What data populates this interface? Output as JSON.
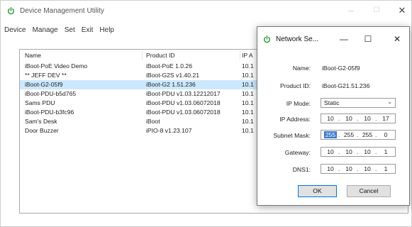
{
  "main_window": {
    "title": "Device Management Utility",
    "menu": [
      "Device",
      "Manage",
      "Set",
      "Exit",
      "Help"
    ],
    "controls": {
      "minimize": "–",
      "maximize": "☐",
      "close": "✕"
    }
  },
  "device_list": {
    "headers": [
      "Name",
      "Product ID",
      "IP A"
    ],
    "rows": [
      [
        "iBoot-PoE Video Demo",
        "iBoot-PoE 1.0.26",
        "10.1"
      ],
      [
        "** JEFF DEV **",
        "iBoot-G2S v1.40.21",
        "10.1"
      ],
      [
        "iBoot-G2-05f9",
        "iBoot-G2 1.51.236",
        "10.1"
      ],
      [
        "iBoot-PDU-b5d765",
        "iBoot-PDU v1.03.12212017",
        "10.1"
      ],
      [
        "Sams PDU",
        "iBoot-PDU v1.03.06072018",
        "10.1"
      ],
      [
        "iBoot-PDU-b3fc96",
        "iBoot-PDU v1.03.06072018",
        "10.1"
      ],
      [
        "Sam's Desk",
        "iBoot",
        "10.1"
      ],
      [
        "Door Buzzer",
        "iPIO-8 v1.23.107",
        "10.1"
      ]
    ],
    "selected_index": 2
  },
  "dialog": {
    "title": "Network Se...",
    "controls": {
      "minimize": "—",
      "maximize": "☐",
      "close": "✕"
    },
    "name_label": "Name:",
    "name_value": "iBoot-G2-05f9",
    "product_id_label": "Product ID:",
    "product_id_value": "iBoot-G21.51.236",
    "ip_mode_label": "IP Mode:",
    "ip_mode_value": "Static",
    "ip_address_label": "IP Address:",
    "ip_address": [
      "10",
      "10",
      "10",
      "17"
    ],
    "subnet_mask_label": "Subnet Mask:",
    "subnet_mask": [
      "255",
      "255",
      "255",
      "0"
    ],
    "gateway_label": "Gateway:",
    "gateway": [
      "10",
      "10",
      "10",
      "1"
    ],
    "dns1_label": "DNS1:",
    "dns1": [
      "10",
      "10",
      "10",
      "1"
    ],
    "ok_label": "OK",
    "cancel_label": "Cancel"
  },
  "colors": {
    "selection": "#cce8ff",
    "power_icon": "#2ea043",
    "highlight": "#3c79d0"
  }
}
